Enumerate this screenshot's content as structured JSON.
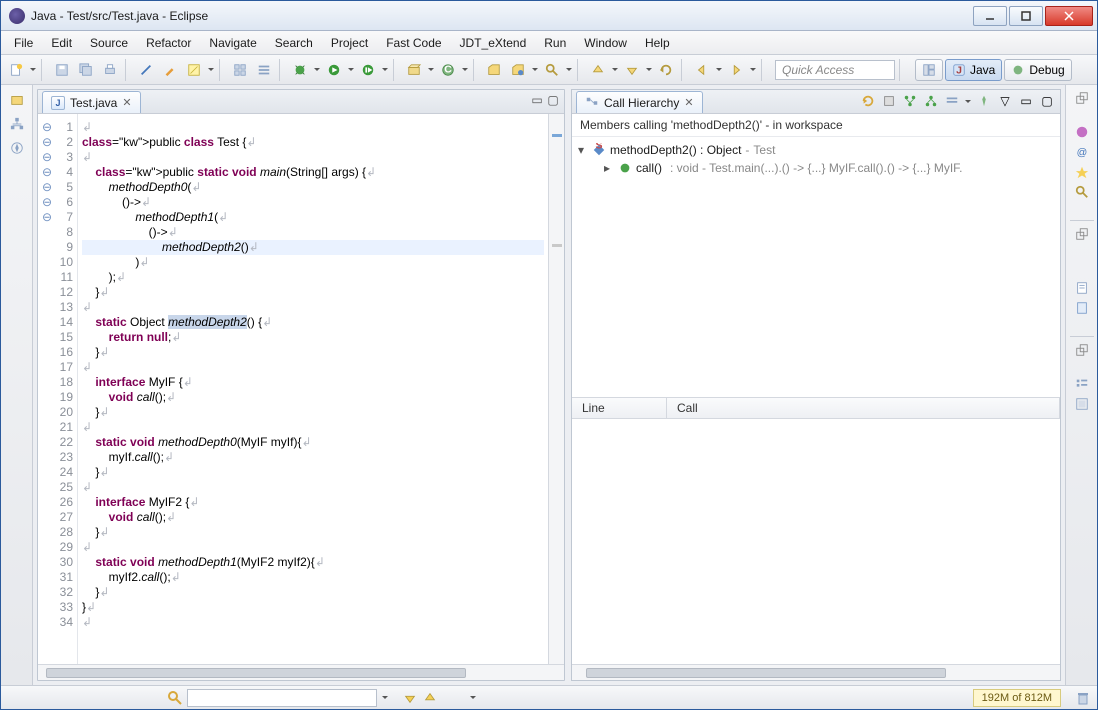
{
  "title": "Java - Test/src/Test.java - Eclipse",
  "menu": [
    "File",
    "Edit",
    "Source",
    "Refactor",
    "Navigate",
    "Search",
    "Project",
    "Fast Code",
    "JDT_eXtend",
    "Run",
    "Window",
    "Help"
  ],
  "quick_access_placeholder": "Quick Access",
  "perspectives": {
    "java": "Java",
    "debug": "Debug"
  },
  "editor_tab": {
    "label": "Test.java"
  },
  "code_lines": [
    "",
    "public class Test {",
    "",
    "    public static void main(String[] args) {",
    "        methodDepth0(",
    "            ()->",
    "                methodDepth1(",
    "                    ()->",
    "                        methodDepth2()",
    "                )",
    "        );",
    "    }",
    "",
    "    static Object methodDepth2() {",
    "        return null;",
    "    }",
    "",
    "    interface MyIF {",
    "        void call();",
    "    }",
    "",
    "    static void methodDepth0(MyIF myIf){",
    "        myIf.call();",
    "    }",
    "",
    "    interface MyIF2 {",
    "        void call();",
    "    }",
    "",
    "    static void methodDepth1(MyIF2 myIf2){",
    "        myIf2.call();",
    "    }",
    "}",
    ""
  ],
  "highlight_line": 9,
  "call_hierarchy": {
    "tab_label": "Call Hierarchy",
    "description": "Members calling 'methodDepth2()' - in workspace",
    "root": {
      "sig": "methodDepth2() : Object",
      "cls": "Test"
    },
    "child": {
      "sig": "call()",
      "detail": ": void - Test.main(...).() -> {...} MyIF.call().() -> {...} MyIF."
    },
    "columns": [
      "Line",
      "Call"
    ]
  },
  "heap": "192M of 812M"
}
